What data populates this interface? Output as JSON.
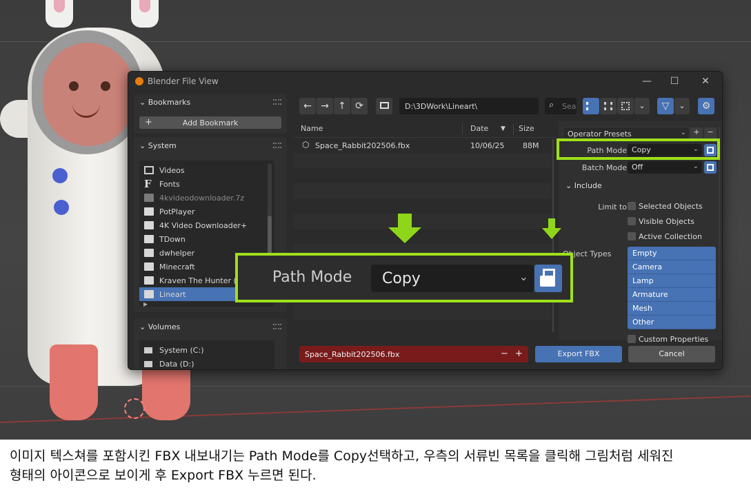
{
  "window": {
    "title": "Blender File View",
    "controls": {
      "minimize": "—",
      "maximize": "☐",
      "close": "✕"
    }
  },
  "sidebar": {
    "bookmarks": {
      "title": "Bookmarks",
      "add_label": "Add Bookmark"
    },
    "system": {
      "title": "System",
      "items": [
        {
          "label": "Videos",
          "icon": "film-icon"
        },
        {
          "label": "Fonts",
          "icon": "font-icon"
        },
        {
          "label": "4kvideodownloader.7z",
          "icon": "folder-icon"
        },
        {
          "label": "PotPlayer",
          "icon": "folder-icon"
        },
        {
          "label": "4K Video Downloader+",
          "icon": "folder-icon"
        },
        {
          "label": "TDown",
          "icon": "folder-icon"
        },
        {
          "label": "dwhelper",
          "icon": "folder-icon"
        },
        {
          "label": "Minecraft",
          "icon": "folder-icon"
        },
        {
          "label": "Kraven The Hunter (",
          "icon": "folder-icon"
        },
        {
          "label": "Lineart",
          "icon": "folder-icon"
        }
      ]
    },
    "volumes": {
      "title": "Volumes",
      "items": [
        {
          "label": "System (C:)",
          "icon": "drive-icon"
        },
        {
          "label": "Data (D:)",
          "icon": "drive-icon"
        }
      ]
    }
  },
  "toolbar": {
    "back": "←",
    "forward": "→",
    "parent": "↑",
    "refresh": "⟳",
    "path": "D:\\3DWork\\Lineart\\",
    "search_placeholder": "Sea"
  },
  "filelist": {
    "columns": {
      "name": "Name",
      "date": "Date",
      "size": "Size"
    },
    "rows": [
      {
        "name": "Space_Rabbit202506.fbx",
        "date": "10/06/25",
        "size": "88M"
      }
    ]
  },
  "operator": {
    "presets_label": "Operator Presets",
    "plus": "+",
    "minus": "−",
    "path_mode": {
      "label": "Path Mode",
      "value": "Copy"
    },
    "batch_mode": {
      "label": "Batch Mode",
      "value": "Off"
    },
    "include_title": "Include",
    "limit_to": {
      "label": "Limit to",
      "options": [
        "Selected Objects",
        "Visible Objects",
        "Active Collection"
      ]
    },
    "object_types": {
      "label": "Object Types",
      "items": [
        "Empty",
        "Camera",
        "Lamp",
        "Armature",
        "Mesh",
        "Other"
      ]
    },
    "custom_properties": "Custom Properties"
  },
  "footer": {
    "filename": "Space_Rabbit202506.fbx",
    "minus": "−",
    "plus": "+",
    "export_label": "Export FBX",
    "cancel_label": "Cancel"
  },
  "zoom_callout": {
    "label": "Path Mode",
    "value": "Copy",
    "chevron": "⌄"
  },
  "caption": {
    "line1": "이미지 텍스쳐를 포함시킨 FBX 내보내기는 Path Mode를 Copy선택하고,  우측의 서류빈 목록을 클릭해 그림처럼 세워진",
    "line2": "형태의 아이콘으로 보이게 후 Export FBX 누르면 된다."
  },
  "colors": {
    "accent": "#4772b3",
    "highlight": "#9fe01a",
    "filename_bg": "#7a1b1b"
  }
}
